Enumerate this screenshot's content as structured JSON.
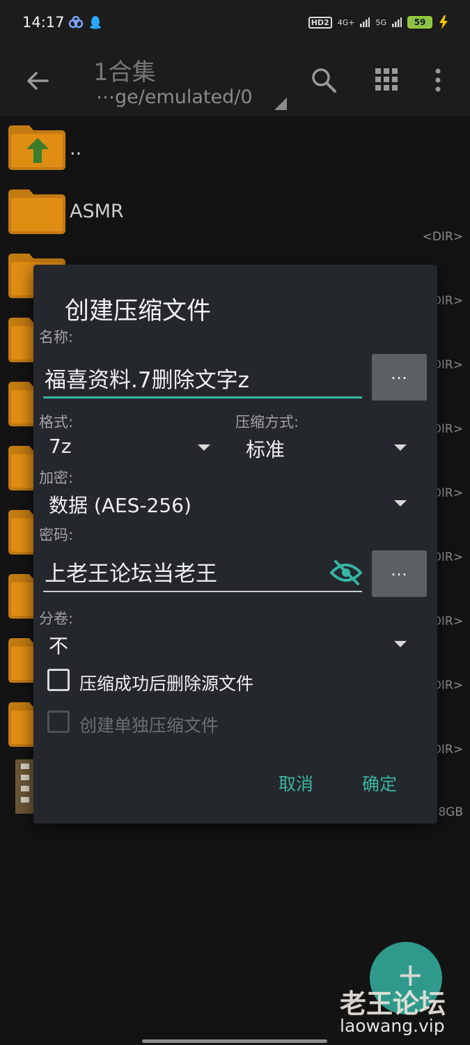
{
  "status_bar": {
    "time": "14:17",
    "hd_label": "HD2",
    "net1_label": "4G+",
    "net2_label": "5G",
    "battery": "59"
  },
  "toolbar": {
    "title": "1合集",
    "path": "⋯ge/emulated/0",
    "back_icon": "arrow-left-icon",
    "search_icon": "search-icon",
    "grid_icon": "grid-view-icon",
    "more_icon": "more-vert-icon"
  },
  "file_list": {
    "up_label": "..",
    "first_folder": "ASMR",
    "dir_tag": "<DIR>",
    "partial_tags": [
      "DIR>",
      "DIR>",
      "DIR>",
      "DIR>",
      "DIR>",
      "DIR>",
      "DIR>",
      "DIR>"
    ],
    "size_partial": "8GB"
  },
  "dialog": {
    "title": "创建压缩文件",
    "name_label": "名称:",
    "name_value": "福喜资料.7删除文字z",
    "dots_label": "...",
    "format_label": "格式:",
    "format_value": "7z",
    "compression_label": "压缩方式:",
    "compression_value": "标准",
    "encryption_label": "加密:",
    "encryption_value": "数据 (AES-256)",
    "password_label": "密码:",
    "password_value": "上老王论坛当老王",
    "split_label": "分卷:",
    "split_value": "不",
    "delete_source_label": "压缩成功后删除源文件",
    "delete_source_checked": false,
    "separate_archives_label": "创建单独压缩文件",
    "separate_archives_enabled": false,
    "cancel_label": "取消",
    "ok_label": "确定",
    "accent_color": "#3bb3a2"
  },
  "fab": {
    "label": "+"
  },
  "watermark": {
    "line1": "老王论坛",
    "line2": "laowang.vip"
  }
}
